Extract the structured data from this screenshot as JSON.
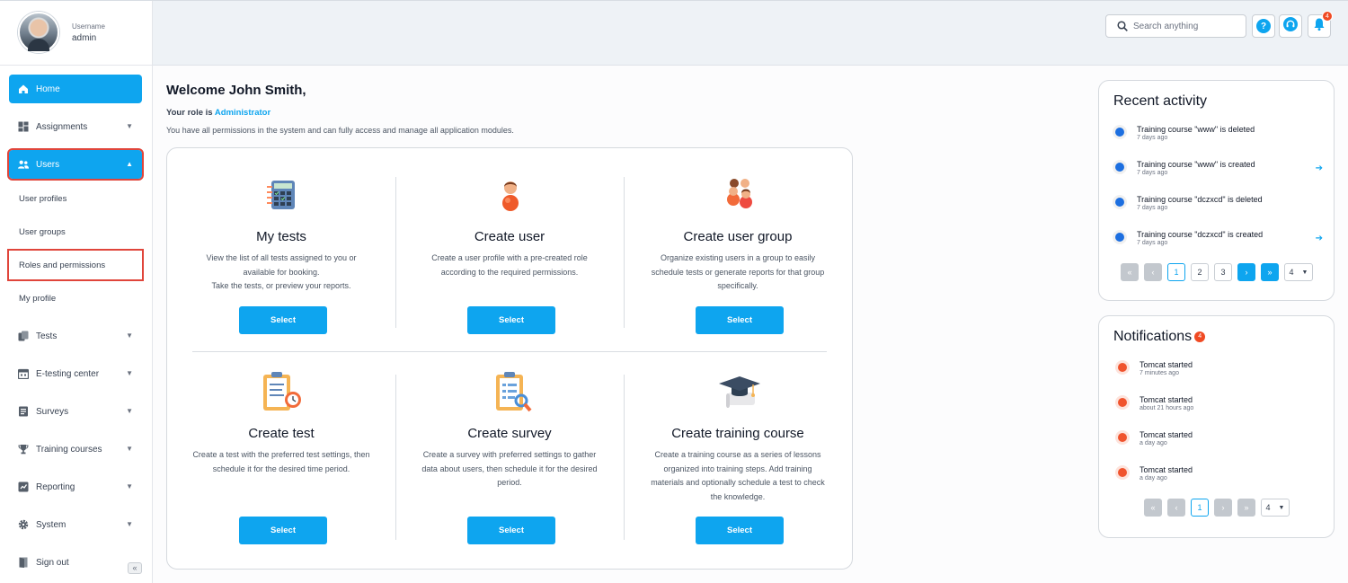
{
  "user": {
    "username_label": "Username",
    "username": "admin"
  },
  "nav": {
    "home": "Home",
    "assignments": "Assignments",
    "users": "Users",
    "users_sub": [
      "User profiles",
      "User groups",
      "Roles and permissions",
      "My profile"
    ],
    "tests": "Tests",
    "etesting": "E-testing center",
    "surveys": "Surveys",
    "training": "Training courses",
    "reporting": "Reporting",
    "system": "System",
    "signout": "Sign out",
    "collapse_glyph": "«"
  },
  "topbar": {
    "search_placeholder": "Search anything",
    "help_glyph": "?",
    "notifications_count": "4"
  },
  "main": {
    "welcome": "Welcome John Smith,",
    "role_prefix": "Your role is",
    "role": "Administrator",
    "permissions_text": "You have all permissions in the system and can fully access and manage all application modules.",
    "select_label": "Select",
    "cards": [
      {
        "title": "My tests",
        "desc": "View the list of all tests assigned to you or available for booking.\nTake the tests, or preview your reports.",
        "icon": "tests-calculator-icon"
      },
      {
        "title": "Create user",
        "desc": "Create a user profile with a pre-created role according to the required permissions.",
        "icon": "user-icon"
      },
      {
        "title": "Create user group",
        "desc": "Organize existing users in a group to easily schedule tests or generate reports for that group specifically.",
        "icon": "user-group-icon"
      },
      {
        "title": "Create test",
        "desc": "Create a test with the preferred test settings, then schedule it for the desired time period.",
        "icon": "test-clipboard-icon"
      },
      {
        "title": "Create survey",
        "desc": "Create a survey with preferred settings to gather data about users, then schedule it for the desired period.",
        "icon": "survey-clipboard-icon"
      },
      {
        "title": "Create training course",
        "desc": "Create a training course as a series of lessons organized into training steps. Add training materials and optionally schedule a test to check the knowledge.",
        "icon": "graduation-cap-icon"
      }
    ]
  },
  "recent_activity": {
    "title": "Recent activity",
    "items": [
      {
        "text": "Training course \"www\" is deleted",
        "time": "7 days ago"
      },
      {
        "text": "Training course \"www\" is created",
        "time": "7 days ago"
      },
      {
        "text": "Training course \"dczxcd\" is deleted",
        "time": "7 days ago"
      },
      {
        "text": "Training course \"dczxcd\" is created",
        "time": "7 days ago"
      }
    ],
    "pages": [
      "1",
      "2",
      "3"
    ],
    "page_size": "4",
    "dot_color": "#1d6fe0"
  },
  "notifications": {
    "title": "Notifications",
    "count": "4",
    "items": [
      {
        "text": "Tomcat started",
        "time": "7 minutes ago"
      },
      {
        "text": "Tomcat started",
        "time": "about 21 hours ago"
      },
      {
        "text": "Tomcat started",
        "time": "a day ago"
      },
      {
        "text": "Tomcat started",
        "time": "a day ago"
      }
    ],
    "pages": [
      "1"
    ],
    "page_size": "4",
    "dot_color": "#f0532d"
  },
  "colors": {
    "accent": "#0ea5ef",
    "highlight_border": "#e0453b",
    "badge": "#f04a23"
  }
}
